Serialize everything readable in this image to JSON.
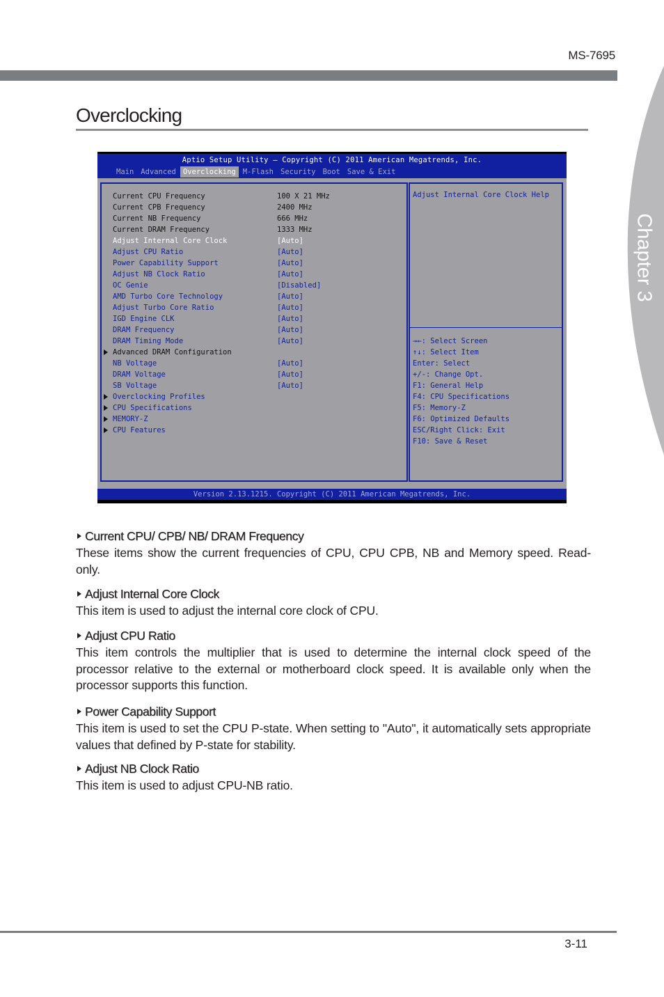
{
  "header": {
    "model": "MS-7695",
    "chapter_label": "Chapter 3"
  },
  "section": {
    "title": "Overclocking"
  },
  "bios": {
    "title": "Aptio Setup Utility – Copyright (C) 2011 American Megatrends, Inc.",
    "tabs": [
      {
        "label": "Main",
        "active": false
      },
      {
        "label": "Advanced",
        "active": false
      },
      {
        "label": "Overclocking",
        "active": true
      },
      {
        "label": "M-Flash",
        "active": false
      },
      {
        "label": "Security",
        "active": false
      },
      {
        "label": "Boot",
        "active": false
      },
      {
        "label": "Save & Exit",
        "active": false
      }
    ],
    "items": [
      {
        "label": "Current CPU Frequency",
        "value": "100 X 21 MHz",
        "style": "readonly"
      },
      {
        "label": "Current CPB Frequency",
        "value": "2400 MHz",
        "style": "readonly"
      },
      {
        "label": "Current NB Frequency",
        "value": "666 MHz",
        "style": "readonly"
      },
      {
        "label": "Current DRAM Frequency",
        "value": "1333 MHz",
        "style": "readonly"
      },
      {
        "label": "Adjust Internal Core Clock",
        "value": "[Auto]",
        "style": "selected"
      },
      {
        "label": "Adjust CPU Ratio",
        "value": "[Auto]",
        "style": "option"
      },
      {
        "label": "Power Capability Support",
        "value": "[Auto]",
        "style": "option"
      },
      {
        "label": "Adjust NB Clock Ratio",
        "value": "[Auto]",
        "style": "option"
      },
      {
        "label": "OC Genie",
        "value": "[Disabled]",
        "style": "option"
      },
      {
        "label": "AMD Turbo Core Technology",
        "value": "[Auto]",
        "style": "option"
      },
      {
        "label": "Adjust Turbo Core Ratio",
        "value": "[Auto]",
        "style": "option"
      },
      {
        "label": "IGD Engine CLK",
        "value": "[Auto]",
        "style": "option"
      },
      {
        "label": "DRAM Frequency",
        "value": "[Auto]",
        "style": "option"
      },
      {
        "label": "DRAM Timing Mode",
        "value": "[Auto]",
        "style": "option"
      },
      {
        "label": "Advanced DRAM Configuration",
        "value": "",
        "style": "submenu-black"
      },
      {
        "label": "NB Voltage",
        "value": "[Auto]",
        "style": "option"
      },
      {
        "label": "DRAM Voltage",
        "value": "[Auto]",
        "style": "option"
      },
      {
        "label": "SB Voltage",
        "value": "[Auto]",
        "style": "option"
      },
      {
        "label": "Overclocking Profiles",
        "value": "",
        "style": "submenu"
      },
      {
        "label": "CPU Specifications",
        "value": "",
        "style": "submenu"
      },
      {
        "label": "MEMORY-Z",
        "value": "",
        "style": "submenu"
      },
      {
        "label": "CPU Features",
        "value": "",
        "style": "submenu"
      }
    ],
    "help_title": "Adjust Internal Core Clock Help",
    "keys": [
      "→←: Select Screen",
      "↑↓: Select Item",
      "Enter: Select",
      "+/-: Change Opt.",
      "F1: General Help",
      "F4: CPU Specifications",
      "F5: Memory-Z",
      "F6: Optimized Defaults",
      "ESC/Right Click: Exit",
      "F10: Save & Reset"
    ],
    "footer": "Version 2.13.1215. Copyright (C) 2011 American Megatrends, Inc.",
    "colors": {
      "bar": "#1020a0",
      "panel": "#a09fa3",
      "selected": "#ffffff",
      "option": "#1020a0",
      "readonly": "#111111"
    }
  },
  "descriptions": [
    {
      "heading": "Current CPU/ CPB/ NB/ DRAM Frequency",
      "body": "These items show the current frequencies of CPU, CPU CPB, NB and Memory speed. Read-only."
    },
    {
      "heading": "Adjust Internal Core Clock",
      "body": "This item is used to adjust the internal core clock of CPU."
    },
    {
      "heading": "Adjust CPU Ratio",
      "body": "This item controls the multiplier that is used to determine the internal clock speed of the processor relative to the external or motherboard clock speed. It is available only when the processor supports this function."
    },
    {
      "heading": "Power Capability Support",
      "body": "This item is used to set the CPU P-state. When setting to \"Auto\", it automatically sets appropriate values that defined by P-state for stability."
    },
    {
      "heading": "Adjust NB Clock Ratio",
      "body": "This item is used to adjust CPU-NB ratio."
    }
  ],
  "footer": {
    "page_number": "3-11"
  }
}
